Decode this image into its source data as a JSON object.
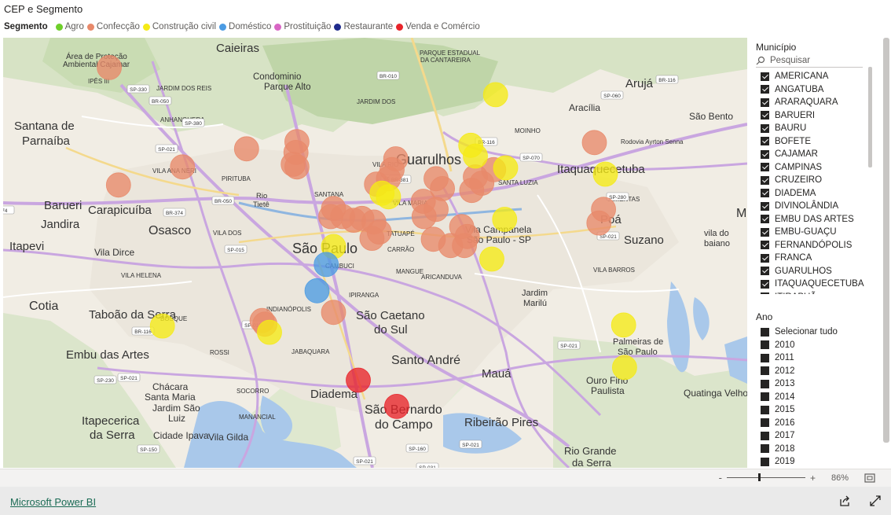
{
  "visual_title": "CEP e Segmento",
  "legend": {
    "title": "Segmento",
    "items": [
      {
        "label": "Agro",
        "color": "#6ecf2a"
      },
      {
        "label": "Confecção",
        "color": "#e8896a"
      },
      {
        "label": "Construção civil",
        "color": "#f5ea16"
      },
      {
        "label": "Doméstico",
        "color": "#4b9be3"
      },
      {
        "label": "Prostituição",
        "color": "#d866c4"
      },
      {
        "label": "Restaurante",
        "color": "#1f2b8c"
      },
      {
        "label": "Venda e Comércio",
        "color": "#e8242a"
      }
    ]
  },
  "map": {
    "labels": {
      "caieiras": "Caieiras",
      "condominio": "Condominio",
      "parque_alto": "Parque Alto",
      "area_protecao": "Área de Proteção",
      "ambiental_cajamar": "Ambiental Cajamar",
      "ipes": "IPÊS III",
      "jardim_dos_reis": "JARDIM DOS REIS",
      "anhanguera": "ANHANGUERA",
      "santana_de": "Santana de",
      "parnaiba": "Parnaíba",
      "vila_ana_neri": "VILA ANA NERI",
      "pirituba": "PIRITUBA",
      "guarulhos": "Guarulhos",
      "itaquaquecetuba": "Itaquaquecetuba",
      "aruja": "Arujá",
      "aracilia": "Aracília",
      "sao_bento": "São Bento",
      "barueri": "Barueri",
      "carapicuiba": "Carapicuíba",
      "jandira": "Jandira",
      "osasco": "Osasco",
      "itapevi": "Itapevi",
      "vila_dirce": "Vila Dirce",
      "sao_paulo": "São Paulo",
      "poa": "Poá",
      "suzano": "Suzano",
      "cotia": "Cotia",
      "taboao": "Taboão da Serra",
      "sao_caetano": "São Caetano",
      "do_sul": "do Sul",
      "santo_andre": "Santo André",
      "maua": "Mauá",
      "embu_das_artes": "Embu das Artes",
      "diadema": "Diadema",
      "sao_bernardo": "São Bernardo",
      "do_campo": "do Campo",
      "ribeirao_pires": "Ribeirão Pires",
      "rio_grande": "Rio Grande",
      "da_serra": "da Serra",
      "itapecerica": "Itapecerica",
      "da_serra2": "da Serra",
      "chacara": "Chácara",
      "santa_maria": "Santa Maria",
      "jardim_sao": "Jardim São",
      "luiz": "Luiz",
      "cidade_ipava": "Cidade Ipava",
      "vila_gilda": "Vila Gilda",
      "vila_campanela": "Vila Campanela",
      "sao_paulo_sp": "São Paulo - SP",
      "jardim_marilu_1": "Jardim",
      "jardim_marilu_2": "Marilú",
      "palmeiras_1": "Palmeiras de",
      "palmeiras_2": "São Paulo",
      "ouro_fino_1": "Ouro Fino",
      "ouro_fino_2": "Paulista",
      "quatinga": "Quatinga Velho",
      "vila_de_baiano_1": "vila do",
      "vila_de_baiano_2": "baiano",
      "pq_cantareira_1": "PARQUE ESTADUAL",
      "pq_cantareira_2": "DA CANTAREIRA",
      "jardim_dos_pinheiros": "JARDIM DOS",
      "pimentas": "PIMENTAS",
      "moinho": "MOINHO",
      "vila_rio": "VILA RIO",
      "santa_luzia": "SANTA LUZIA",
      "vila_maria": "VILA MARIA",
      "santana": "SANTANA",
      "tatuape": "TATUAPÉ",
      "carrao": "CARRÃO",
      "aricanduva": "ARICANDUVA",
      "cambuci": "CAMBUCI",
      "indianopolis": "INDIANÓPOLIS",
      "jabaquara": "JABAQUARA",
      "rossi": "ROSSI",
      "socorro": "SOCORRO",
      "vila_dos_remedios": "VILA DOS",
      "vila_barros": "VILA BARROS",
      "rio_tiete_1": "Rio",
      "rio_tiete_2": "Tietê",
      "ayrton_senna": "Rodovia Ayrton Senna",
      "ma": "Ma",
      "ipiranga": "IPIRANGA",
      "vila_helena": "VILA HELENA",
      "manancial": "MANANCIAL",
      "mangue": "MANGUE",
      "bosque": "BOSQUE"
    },
    "road_shields": [
      "SP-330",
      "BR-050",
      "BR-010",
      "SP-021",
      "SP-380",
      "BR-116",
      "SP-060",
      "BR-116",
      "SP-070",
      "SP-021",
      "SP-280",
      "BR-381",
      "BR-374",
      "BR-050",
      "SP-015",
      "SP-015",
      "BR-116",
      "SP-021",
      "SP-230",
      "SP-021",
      "SP-150",
      "SP-160",
      "SP-021",
      "SP-021",
      "SP-021",
      "SP-031",
      "374"
    ],
    "points": [
      {
        "lon": -46.87,
        "lat": -23.38,
        "segment": "Confecção"
      },
      {
        "lon": -46.72,
        "lat": -23.47,
        "segment": "Confecção"
      },
      {
        "lon": -46.79,
        "lat": -23.49,
        "segment": "Confecção"
      },
      {
        "lon": -46.86,
        "lat": -23.51,
        "segment": "Confecção"
      },
      {
        "lon": -46.665,
        "lat": -23.462,
        "segment": "Confecção"
      },
      {
        "lon": -46.666,
        "lat": -23.474,
        "segment": "Confecção"
      },
      {
        "lon": -46.669,
        "lat": -23.487,
        "segment": "Confecção"
      },
      {
        "lon": -46.665,
        "lat": -23.49,
        "segment": "Confecção"
      },
      {
        "lon": -46.557,
        "lat": -23.481,
        "segment": "Confecção"
      },
      {
        "lon": -46.561,
        "lat": -23.493,
        "segment": "Confecção"
      },
      {
        "lon": -46.565,
        "lat": -23.503,
        "segment": "Confecção"
      },
      {
        "lon": -46.578,
        "lat": -23.509,
        "segment": "Confecção"
      },
      {
        "lon": -46.513,
        "lat": -23.503,
        "segment": "Confecção"
      },
      {
        "lon": -46.506,
        "lat": -23.514,
        "segment": "Confecção"
      },
      {
        "lon": -46.45,
        "lat": -23.493,
        "segment": "Confecção"
      },
      {
        "lon": -46.47,
        "lat": -23.501,
        "segment": "Confecção"
      },
      {
        "lon": -46.463,
        "lat": -23.508,
        "segment": "Confecção"
      },
      {
        "lon": -46.474,
        "lat": -23.516,
        "segment": "Confecção"
      },
      {
        "lon": -46.34,
        "lat": -23.463,
        "segment": "Confecção"
      },
      {
        "lon": -46.33,
        "lat": -23.537,
        "segment": "Confecção"
      },
      {
        "lon": -46.335,
        "lat": -23.552,
        "segment": "Confecção"
      },
      {
        "lon": -46.625,
        "lat": -23.536,
        "segment": "Confecção"
      },
      {
        "lon": -46.628,
        "lat": -23.545,
        "segment": "Confecção"
      },
      {
        "lon": -46.615,
        "lat": -23.545,
        "segment": "Confecção"
      },
      {
        "lon": -46.603,
        "lat": -23.549,
        "segment": "Confecção"
      },
      {
        "lon": -46.594,
        "lat": -23.547,
        "segment": "Confecção"
      },
      {
        "lon": -46.581,
        "lat": -23.551,
        "segment": "Confecção"
      },
      {
        "lon": -46.575,
        "lat": -23.562,
        "segment": "Confecção"
      },
      {
        "lon": -46.583,
        "lat": -23.569,
        "segment": "Confecção"
      },
      {
        "lon": -46.526,
        "lat": -23.545,
        "segment": "Confecção"
      },
      {
        "lon": -46.513,
        "lat": -23.537,
        "segment": "Confecção"
      },
      {
        "lon": -46.527,
        "lat": -23.528,
        "segment": "Confecção"
      },
      {
        "lon": -46.516,
        "lat": -23.57,
        "segment": "Confecção"
      },
      {
        "lon": -46.497,
        "lat": -23.577,
        "segment": "Confecção"
      },
      {
        "lon": -46.485,
        "lat": -23.556,
        "segment": "Confecção"
      },
      {
        "lon": -46.479,
        "lat": -23.567,
        "segment": "Confecção"
      },
      {
        "lon": -46.482,
        "lat": -23.577,
        "segment": "Confecção"
      },
      {
        "lon": -46.625,
        "lat": -23.651,
        "segment": "Confecção"
      },
      {
        "lon": -46.703,
        "lat": -23.66,
        "segment": "Confecção"
      },
      {
        "lon": -46.7,
        "lat": -23.664,
        "segment": "Confecção"
      },
      {
        "lon": -46.437,
        "lat": -23.491,
        "segment": "Construção civil"
      },
      {
        "lon": -46.475,
        "lat": -23.466,
        "segment": "Construção civil"
      },
      {
        "lon": -46.47,
        "lat": -23.478,
        "segment": "Construção civil"
      },
      {
        "lon": -46.448,
        "lat": -23.41,
        "segment": "Construção civil"
      },
      {
        "lon": -46.572,
        "lat": -23.519,
        "segment": "Construção civil"
      },
      {
        "lon": -46.565,
        "lat": -23.523,
        "segment": "Construção civil"
      },
      {
        "lon": -46.438,
        "lat": -23.548,
        "segment": "Construção civil"
      },
      {
        "lon": -46.452,
        "lat": -23.592,
        "segment": "Construção civil"
      },
      {
        "lon": -46.328,
        "lat": -23.498,
        "segment": "Construção civil"
      },
      {
        "lon": -46.625,
        "lat": -23.578,
        "segment": "Construção civil"
      },
      {
        "lon": -46.695,
        "lat": -23.673,
        "segment": "Construção civil"
      },
      {
        "lon": -46.812,
        "lat": -23.666,
        "segment": "Construção civil"
      },
      {
        "lon": -46.308,
        "lat": -23.665,
        "segment": "Construção civil"
      },
      {
        "lon": -46.307,
        "lat": -23.712,
        "segment": "Construção civil"
      },
      {
        "lon": -46.633,
        "lat": -23.598,
        "segment": "Doméstico"
      },
      {
        "lon": -46.643,
        "lat": -23.627,
        "segment": "Doméstico"
      },
      {
        "lon": -46.598,
        "lat": -23.726,
        "segment": "Venda e Comércio"
      },
      {
        "lon": -46.556,
        "lat": -23.755,
        "segment": "Venda e Comércio"
      }
    ]
  },
  "slicer_municipio": {
    "title": "Município",
    "search_placeholder": "Pesquisar",
    "items": [
      "AMERICANA",
      "ANGATUBA",
      "ARARAQUARA",
      "BARUERI",
      "BAURU",
      "BOFETE",
      "CAJAMAR",
      "CAMPINAS",
      "CRUZEIRO",
      "DIADEMA",
      "DIVINOLÂNDIA",
      "EMBU DAS ARTES",
      "EMBU-GUAÇU",
      "FERNANDÓPOLIS",
      "FRANCA",
      "GUARULHOS",
      "ITAQUAQUECETUBA",
      "ITIRAPUÃ"
    ],
    "all_checked": true
  },
  "slicer_ano": {
    "title": "Ano",
    "items": [
      "Selecionar tudo",
      "2010",
      "2011",
      "2012",
      "2013",
      "2014",
      "2015",
      "2016",
      "2017",
      "2018",
      "2019"
    ]
  },
  "zoom": {
    "minus": "-",
    "plus": "+",
    "value_text": "86%",
    "value": 0.86
  },
  "footer": {
    "link_text": "Microsoft Power BI"
  }
}
